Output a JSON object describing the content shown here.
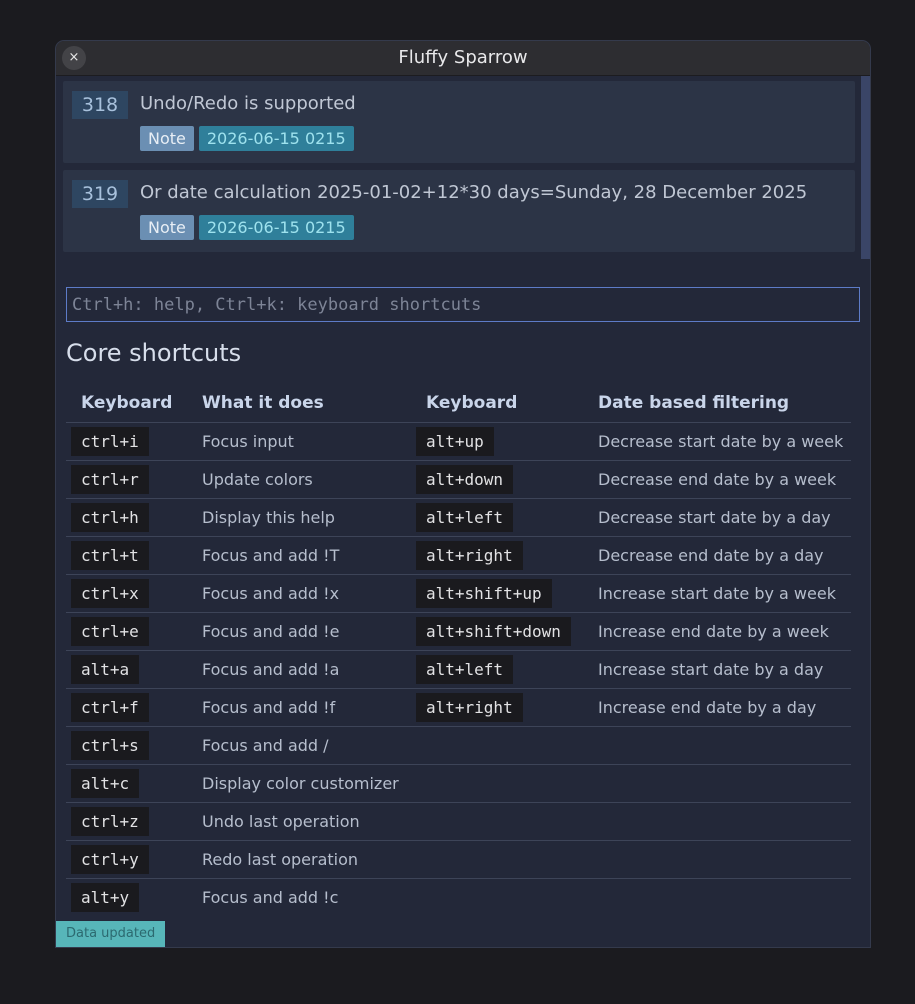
{
  "window": {
    "title": "Fluffy Sparrow",
    "close_icon": "×"
  },
  "notes": [
    {
      "id": "318",
      "text": "Undo/Redo is supported",
      "tag": "Note",
      "date": "2026-06-15 0215"
    },
    {
      "id": "319",
      "text": "Or date calculation 2025-01-02+12*30 days=Sunday, 28 December 2025",
      "tag": "Note",
      "date": "2026-06-15 0215"
    }
  ],
  "input": {
    "placeholder": "Ctrl+h: help, Ctrl+k: keyboard shortcuts",
    "value": ""
  },
  "section_title": "Core shortcuts",
  "table": {
    "headers": [
      "Keyboard",
      "What it does",
      "Keyboard",
      "Date based filtering"
    ],
    "rows": [
      [
        "ctrl+i",
        "Focus input",
        "alt+up",
        "Decrease start date by a week"
      ],
      [
        "ctrl+r",
        "Update colors",
        "alt+down",
        "Decrease end date by a week"
      ],
      [
        "ctrl+h",
        "Display this help",
        "alt+left",
        "Decrease start date by a day"
      ],
      [
        "ctrl+t",
        "Focus and add !T",
        "alt+right",
        "Decrease end date by a day"
      ],
      [
        "ctrl+x",
        "Focus and add !x",
        "alt+shift+up",
        "Increase start date by a week"
      ],
      [
        "ctrl+e",
        "Focus and add !e",
        "alt+shift+down",
        "Increase end date by a week"
      ],
      [
        "alt+a",
        "Focus and add !a",
        "alt+left",
        "Increase start date by a day"
      ],
      [
        "ctrl+f",
        "Focus and add !f",
        "alt+right",
        "Increase end date by a day"
      ],
      [
        "ctrl+s",
        "Focus and add /",
        "",
        ""
      ],
      [
        "alt+c",
        "Display color customizer",
        "",
        ""
      ],
      [
        "ctrl+z",
        "Undo last operation",
        "",
        ""
      ],
      [
        "ctrl+y",
        "Redo last operation",
        "",
        ""
      ],
      [
        "alt+y",
        "Focus and add !c",
        "",
        ""
      ]
    ]
  },
  "status": "Data updated"
}
